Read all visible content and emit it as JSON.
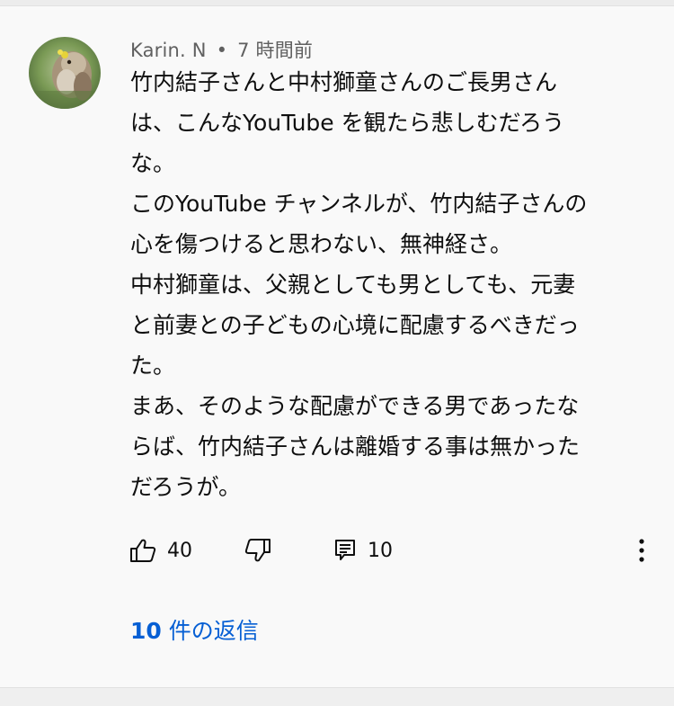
{
  "comment": {
    "author": "Karin. N",
    "separator": "•",
    "time": "7 時間前",
    "lines": [
      "竹内結子さんと中村獅童さんのご長男さん",
      "は、こんなYouTube を観たら悲しむだろう",
      "な。",
      "このYouTube チャンネルが、竹内結子さんの",
      "心を傷つけると思わない、無神経さ。",
      "中村獅童は、父親としても男としても、元妻",
      "と前妻との子どもの心境に配慮するべきだっ",
      "た。",
      "まあ、そのような配慮ができる男であったな",
      "らば、竹内結子さんは離婚する事は無かった",
      "だろうが。"
    ],
    "likes": "40",
    "replies_count": "10",
    "replies_link": {
      "number": "10",
      "text": " 件の返信"
    }
  },
  "colors": {
    "link": "#065fd4",
    "meta": "#606060",
    "text": "#0f0f0f",
    "background": "#f9f9f9"
  },
  "icons": {
    "like": "thumb-up-icon",
    "dislike": "thumb-down-icon",
    "reply": "comment-icon",
    "more": "more-vert-icon"
  }
}
